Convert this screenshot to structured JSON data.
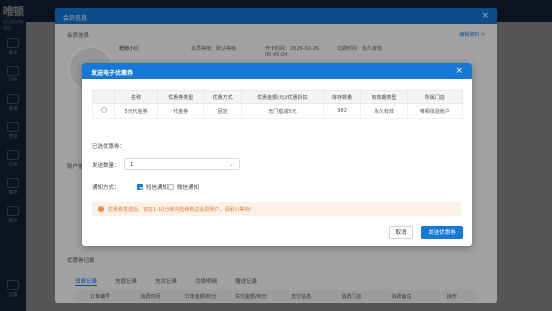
{
  "app": {
    "logo": "唯顿",
    "logo_sub": "自己搞店铺管理"
  },
  "nav": [
    "会员",
    "VIP",
    "收银",
    "营销",
    "订单",
    "库存",
    "统计",
    "设置"
  ],
  "member_modal": {
    "title": "会员信息",
    "section_basic": "会员信息",
    "edit_link": "编辑资料 >",
    "name": "赠驰小O",
    "level_label": "会员等级：默认等级",
    "open_time": "开卡时间：2026-02-26 00:45:04",
    "expire": "过期时间：永久有效",
    "section_account": "账户信息",
    "section_coupon": "优惠券记录",
    "tabs": [
      "消费记录",
      "充值记录",
      "充次记录",
      "兑换明细",
      "赠送记录"
    ],
    "table_headers": [
      "订单编号",
      "消费时间",
      "订单金额/积分",
      "实付金额/积分",
      "支付信息",
      "消费门店",
      "消费备注",
      "操作"
    ]
  },
  "dialog": {
    "title": "发送电子优惠券",
    "close": "×",
    "headers": [
      "名称",
      "优惠券类型",
      "优惠方式",
      "优惠金额(元)/优惠折扣",
      "库存数量",
      "有效期类型",
      "所属门店"
    ],
    "rows": [
      {
        "name": "5元代金券",
        "type": "代金券",
        "method": "固定",
        "amount": "无门槛减5元",
        "stock": "982",
        "validity": "永久有效",
        "store": "唯顿体验账户"
      }
    ],
    "selected_label": "已选优惠券：",
    "qty_label": "发送数量：",
    "qty_value": "1",
    "notify_label": "通知方式：",
    "notify_sms": "短信通知",
    "notify_wechat": "微信通知",
    "sms_checked": true,
    "wechat_checked": false,
    "warning": "优惠券发送后，将在1-10分钟内陆续到达会员账户，请耐心等待！",
    "cancel": "取消",
    "submit": "发送优惠券"
  },
  "colors": {
    "primary": "#1677d8",
    "warning": "#e07a3a",
    "warning_bg": "#fdf0e6"
  }
}
